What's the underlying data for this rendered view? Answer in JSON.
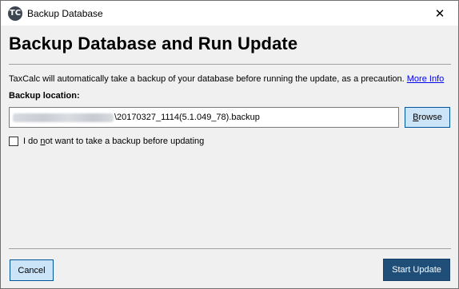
{
  "window": {
    "title": "Backup Database",
    "app_icon_text": "TC",
    "close_glyph": "✕"
  },
  "heading": "Backup Database and Run Update",
  "description": {
    "text": "TaxCalc will automatically take a backup of your database before running the update, as a precaution.",
    "link": "More Info"
  },
  "backup_location": {
    "label": "Backup location:",
    "path_visible": "\\20170327_1114(5.1.049_78).backup"
  },
  "browse_button": {
    "pre": "",
    "mnemonic": "B",
    "post": "rowse"
  },
  "checkbox": {
    "checked": false,
    "label_pre": "I do ",
    "label_mnemonic": "n",
    "label_post": "ot want to take a backup before updating"
  },
  "buttons": {
    "cancel": "Cancel",
    "start_update": "Start Update"
  },
  "colors": {
    "primary_button": "#1f4e79",
    "secondary_button": "#cce4f7",
    "link": "#0000ee"
  }
}
